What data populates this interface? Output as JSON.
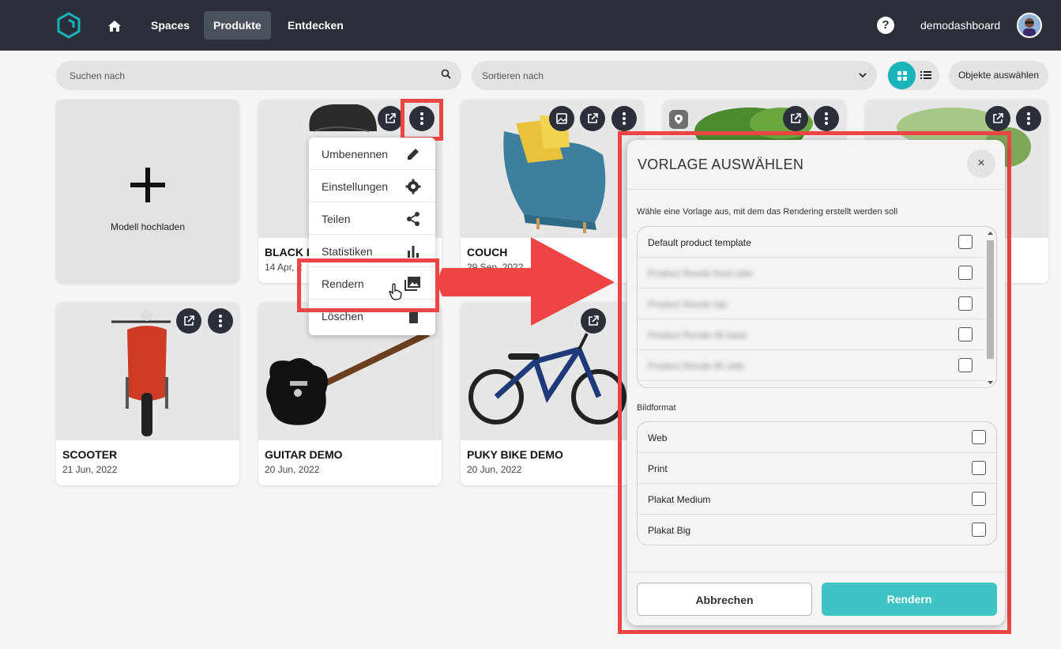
{
  "nav": {
    "links": [
      "Spaces",
      "Produkte",
      "Entdecken"
    ],
    "help": "?",
    "username": "demodashboard"
  },
  "toolbar": {
    "search_placeholder": "Suchen nach",
    "sort_placeholder": "Sortieren nach",
    "select_objects": "Objekte auswählen"
  },
  "upload": {
    "label": "Modell hochladen"
  },
  "products": [
    {
      "title": "BLACK L",
      "date": "14 Apr, 2"
    },
    {
      "title": "COUCH",
      "date": "29 Sep, 2022"
    },
    {
      "title": "SCOOTER",
      "date": "21 Jun, 2022"
    },
    {
      "title": "GUITAR DEMO",
      "date": "20 Jun, 2022"
    },
    {
      "title": "PUKY BIKE DEMO",
      "date": "20 Jun, 2022"
    }
  ],
  "context_menu": {
    "items": [
      "Umbenennen",
      "Einstellungen",
      "Teilen",
      "Statistiken",
      "Rendern",
      "Löschen"
    ]
  },
  "modal": {
    "title": "VORLAGE AUSWÄHLEN",
    "close": "×",
    "instruction": "Wähle eine Vorlage aus, mit dem das Rendering erstellt werden soll",
    "templates": [
      "Default product template",
      "Product Rende front side",
      "Product Rende top",
      "Product Rende 45 back",
      "Product Rende 90 side"
    ],
    "format_label": "Bildformat",
    "formats": [
      "Web",
      "Print",
      "Plakat Medium",
      "Plakat Big"
    ],
    "cancel": "Abbrechen",
    "render": "Rendern"
  },
  "colors": {
    "nav_bg": "#2b2f3a",
    "accent": "#19b3ba",
    "render_btn": "#3fc3c4",
    "highlight": "#ef4444"
  },
  "icons": [
    "logo-icon",
    "home-icon",
    "help-icon",
    "search-icon",
    "chevron-down-icon",
    "grid-icon",
    "list-icon",
    "plus-icon",
    "open-external-icon",
    "more-vert-icon",
    "image-icon",
    "location-icon",
    "pencil-icon",
    "gear-icon",
    "share-icon",
    "bar-chart-icon",
    "gallery-icon",
    "trash-icon",
    "close-icon",
    "cursor-hand-icon"
  ]
}
